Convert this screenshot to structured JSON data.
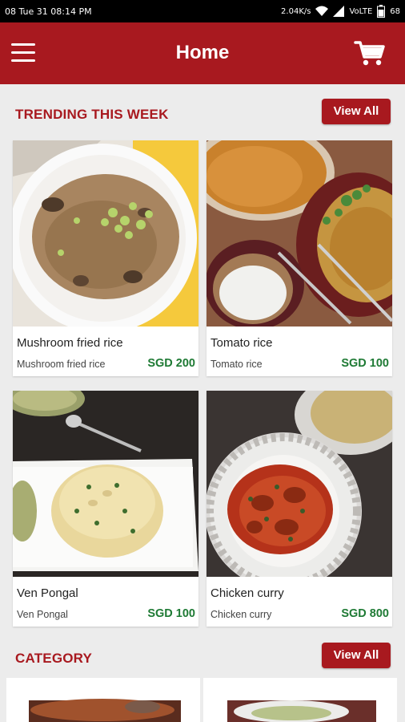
{
  "status": {
    "time": "08 Tue 31 08:14 PM",
    "speed": "2.04K/s",
    "network": "VoLTE",
    "battery": "68"
  },
  "header": {
    "title": "Home"
  },
  "trending": {
    "title": "TRENDING THIS WEEK",
    "view_all": "View All",
    "items": [
      {
        "name": "Mushroom fried rice",
        "subtitle": "Mushroom fried rice",
        "price": "SGD 200"
      },
      {
        "name": "Tomato rice",
        "subtitle": "Tomato rice",
        "price": "SGD 100"
      },
      {
        "name": "Ven Pongal",
        "subtitle": "Ven Pongal",
        "price": "SGD 100"
      },
      {
        "name": "Chicken curry",
        "subtitle": "Chicken curry",
        "price": "SGD 800"
      }
    ]
  },
  "category": {
    "title": "CATEGORY",
    "view_all": "View All"
  },
  "colors": {
    "brand": "#a8191f",
    "price": "#1e7a34",
    "background": "#ececec"
  }
}
